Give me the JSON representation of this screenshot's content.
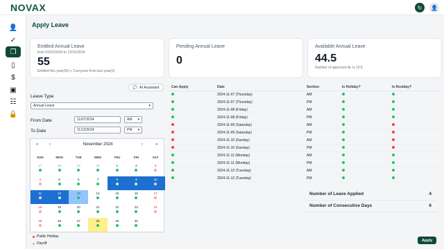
{
  "brand": {
    "logo": "NOVAX"
  },
  "page_title": "Apply Leave",
  "sidebar": {
    "items": [
      {
        "icon": "user-icon"
      },
      {
        "icon": "check-circle-icon"
      },
      {
        "icon": "documents-icon",
        "active": true
      },
      {
        "icon": "file-icon"
      },
      {
        "icon": "dollar-icon"
      },
      {
        "icon": "id-card-icon"
      },
      {
        "icon": "table-icon"
      },
      {
        "icon": "lock-icon"
      }
    ]
  },
  "cards": {
    "entitled": {
      "title": "Entitled Annual Leave",
      "range": "from 01/01/2024 to 12/31/2024",
      "value": "55",
      "note": "Entitled this year(55) + Carryover from last year(0)"
    },
    "pending": {
      "title": "Pending Annual Leave",
      "value": "0"
    },
    "available": {
      "title": "Available Annual Leave",
      "value": "44.5",
      "note": "Number of approved AL is 10.5"
    }
  },
  "ai_button": "AI Assistant",
  "form": {
    "leave_type_label": "Leave Type",
    "leave_type_value": "Annual Leave",
    "from_label": "From Date",
    "from_date": "11/07/2024",
    "from_period": "AM",
    "to_label": "To Date",
    "to_date": "11/12/2024",
    "to_period": "PM"
  },
  "calendar": {
    "month": "November 2024",
    "nav": [
      "«",
      "‹",
      "›",
      "»"
    ],
    "dows": [
      "SUN",
      "MON",
      "TUE",
      "WED",
      "THU",
      "FRI",
      "SAT"
    ],
    "days": [
      "27",
      "28",
      "29",
      "30",
      "1",
      "2",
      "3",
      "4",
      "5",
      "6",
      "7",
      "8",
      "9",
      "10",
      "11",
      "12",
      "13",
      "14",
      "15",
      "16",
      "17",
      "18",
      "19",
      "20",
      "21",
      "22",
      "23",
      "24",
      "25",
      "26",
      "27",
      "28",
      "29",
      "30"
    ]
  },
  "legend": {
    "public_holiday": "Public Holiday",
    "dayoff": "Dayoff"
  },
  "table": {
    "headers": [
      "Can Apply",
      "Date",
      "Section",
      "Is Holiday?",
      "Is Restday?"
    ],
    "rows": [
      {
        "date": "2024-11-07 (Thursday)",
        "section": "AM",
        "can": "green",
        "holiday": "green",
        "rest": "green"
      },
      {
        "date": "2024-11-07 (Thursday)",
        "section": "PM",
        "can": "green",
        "holiday": "green",
        "rest": "green"
      },
      {
        "date": "2024-11-08 (Friday)",
        "section": "AM",
        "can": "green",
        "holiday": "green",
        "rest": "green"
      },
      {
        "date": "2024-11-08 (Friday)",
        "section": "PM",
        "can": "green",
        "holiday": "green",
        "rest": "green"
      },
      {
        "date": "2024-11-09 (Saturday)",
        "section": "AM",
        "can": "red",
        "holiday": "green",
        "rest": "red"
      },
      {
        "date": "2024-11-09 (Saturday)",
        "section": "PM",
        "can": "red",
        "holiday": "green",
        "rest": "red"
      },
      {
        "date": "2024-11-10 (Sunday)",
        "section": "AM",
        "can": "red",
        "holiday": "green",
        "rest": "red"
      },
      {
        "date": "2024-11-10 (Sunday)",
        "section": "PM",
        "can": "red",
        "holiday": "green",
        "rest": "red"
      },
      {
        "date": "2024-11-11 (Monday)",
        "section": "AM",
        "can": "green",
        "holiday": "green",
        "rest": "green"
      },
      {
        "date": "2024-11-11 (Monday)",
        "section": "PM",
        "can": "green",
        "holiday": "green",
        "rest": "green"
      },
      {
        "date": "2024-11-12 (Tuesday)",
        "section": "AM",
        "can": "green",
        "holiday": "green",
        "rest": "green"
      },
      {
        "date": "2024-11-12 (Tuesday)",
        "section": "PM",
        "can": "green",
        "holiday": "green",
        "rest": "green"
      }
    ]
  },
  "summary": {
    "applied_label": "Number of Leave Applied",
    "applied_value": "4",
    "consecutive_label": "Number of Consecutive Days",
    "consecutive_value": "6"
  },
  "apply_button": "Apply",
  "colors": {
    "brand": "#0f4a37",
    "selected": "#1d6fd1",
    "ok": "#22c55e",
    "no": "#ef4444"
  }
}
